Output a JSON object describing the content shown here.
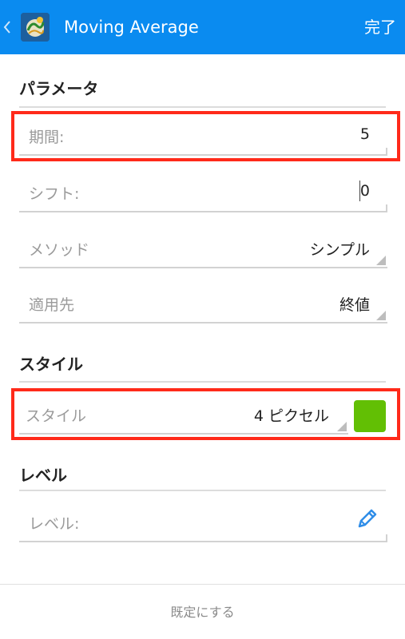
{
  "header": {
    "title": "Moving Average",
    "done_label": "完了",
    "background_color": "#0a8bf0"
  },
  "parameters": {
    "title": "パラメータ",
    "period": {
      "label": "期間:",
      "value": "5"
    },
    "shift": {
      "label": "シフト:",
      "value": "0"
    },
    "method": {
      "label": "メソッド",
      "value": "シンプル"
    },
    "apply_to": {
      "label": "適用先",
      "value": "終値"
    }
  },
  "style": {
    "title": "スタイル",
    "style_field": {
      "label": "スタイル",
      "value": "4 ピクセル"
    },
    "color": "#62bf04"
  },
  "levels": {
    "title": "レベル",
    "level_field": {
      "label": "レベル:"
    }
  },
  "footer": {
    "reset_label": "既定にする"
  },
  "icons": {
    "back": "chevron-left-icon",
    "app": "metatrader-app-icon",
    "edit": "pencil-icon"
  },
  "highlight_color": "#ff2a1a"
}
